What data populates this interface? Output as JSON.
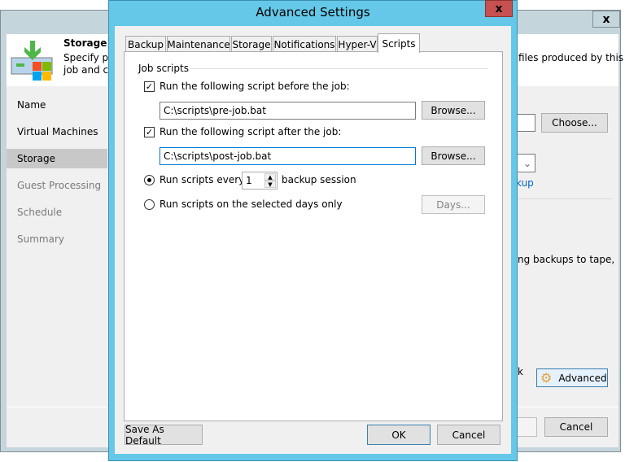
{
  "background_window": {
    "close_label": "x",
    "header_title": "Storage",
    "header_desc_line1": "Specify pr",
    "header_desc_line2": "job and cu",
    "header_desc_right": "files produced by this",
    "nav": [
      {
        "label": "Name",
        "state": "normal"
      },
      {
        "label": "Virtual Machines",
        "state": "normal"
      },
      {
        "label": "Storage",
        "state": "selected"
      },
      {
        "label": "Guest Processing",
        "state": "disabled"
      },
      {
        "label": "Schedule",
        "state": "disabled"
      },
      {
        "label": "Summary",
        "state": "disabled"
      }
    ],
    "choose_label": "Choose...",
    "link_fragment": "kup",
    "text_fragment_tape": "ng backups to tape,",
    "text_fragment_k": "k",
    "advanced_label": "Advanced",
    "cancel_label": "Cancel"
  },
  "dialog": {
    "title": "Advanced Settings",
    "close_label": "x",
    "tabs": [
      {
        "label": "Backup"
      },
      {
        "label": "Maintenance"
      },
      {
        "label": "Storage"
      },
      {
        "label": "Notifications"
      },
      {
        "label": "Hyper-V"
      },
      {
        "label": "Scripts",
        "selected": true
      }
    ],
    "group_label": "Job scripts",
    "before": {
      "label": "Run the following script before the job:",
      "checked": true,
      "value": "C:\\scripts\\pre-job.bat",
      "browse": "Browse..."
    },
    "after": {
      "label": "Run the following script after the job:",
      "checked": true,
      "value": "C:\\scripts\\post-job.bat",
      "browse": "Browse..."
    },
    "every": {
      "label": "Run scripts every",
      "value": "1",
      "suffix": "backup session",
      "selected": true
    },
    "days": {
      "label": "Run scripts on the selected days only",
      "button": "Days...",
      "selected": false
    },
    "save_default": "Save As Default",
    "ok": "OK",
    "cancel": "Cancel"
  }
}
